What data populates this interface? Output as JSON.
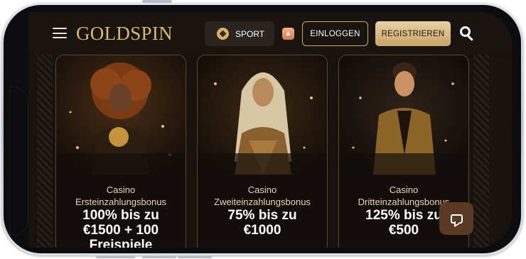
{
  "header": {
    "logo_text": "GOLDSPIN",
    "sport_label": "SPORT",
    "login_label": "EINLOGGEN",
    "register_label": "REGISTRIEREN"
  },
  "cards": [
    {
      "title_line1": "Casino",
      "title_line2": "Ersteinzahlungsbonus",
      "offer_line1": "100% bis zu",
      "offer_line2": "€1500 + 100",
      "offer_line3": "Freispiele"
    },
    {
      "title_line1": "Casino",
      "title_line2": "Zweiteinzahlungsbonus",
      "offer_line1": "75% bis zu",
      "offer_line2": "€1000",
      "offer_line3": ""
    },
    {
      "title_line1": "Casino",
      "title_line2": "Dritteinzahlungsbonus",
      "offer_line1": "125% bis zu",
      "offer_line2": "€500",
      "offer_line3": ""
    }
  ],
  "colors": {
    "accent_gold": "#c9a96b",
    "background": "#1a1411",
    "register_bg": "#d8bb86"
  },
  "icons": [
    "hamburger-menu-icon",
    "soccer-ball-icon",
    "app-icon",
    "search-icon",
    "chat-icon"
  ]
}
